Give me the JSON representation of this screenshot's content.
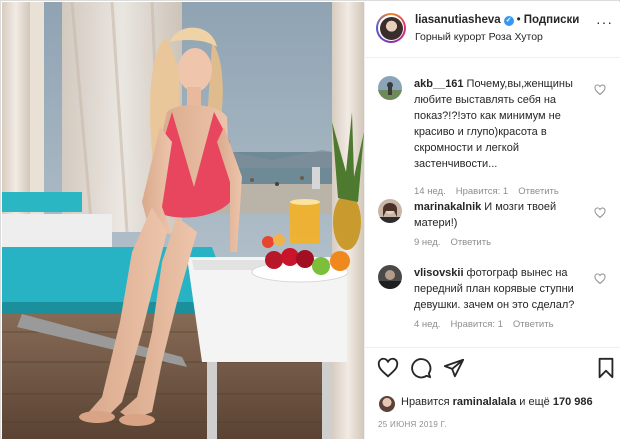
{
  "header": {
    "username": "liasanutiasheva",
    "separator": "•",
    "follow_label": "Подписки",
    "location": "Горный курорт Роза Хутор",
    "more_label": "···"
  },
  "comments": [
    {
      "username": "akb__161",
      "text": "Почему,вы,женщины любите выставлять себя на показ?!?!это как минимум не красиво и глупо)красота в скромности и легкой застенчивости...",
      "time": "14 нед.",
      "likes": "Нравится: 1",
      "reply": "Ответить"
    },
    {
      "username": "marinakalnik",
      "text": "И мозги твоей матери!)",
      "time": "9 нед.",
      "reply": "Ответить"
    },
    {
      "username": "vlisovskii",
      "text": "фотограф вынес на передний план корявые ступни девушки. зачем он это сделал?",
      "time": "4 нед.",
      "likes": "Нравится: 1",
      "reply": "Ответить"
    }
  ],
  "footer": {
    "likes_prefix": "Нравится",
    "likes_user": "raminalalala",
    "likes_mid": "и ещё",
    "likes_count": "170 986",
    "date": "25 ИЮНЯ 2019 Г."
  },
  "icons": [
    "heart-icon",
    "comment-icon",
    "share-icon",
    "bookmark-icon",
    "verified-icon",
    "more-icon"
  ],
  "colors": {
    "link_blue": "#3897f0",
    "muted": "#8e8e8e",
    "text": "#262626",
    "border": "#efefef"
  }
}
